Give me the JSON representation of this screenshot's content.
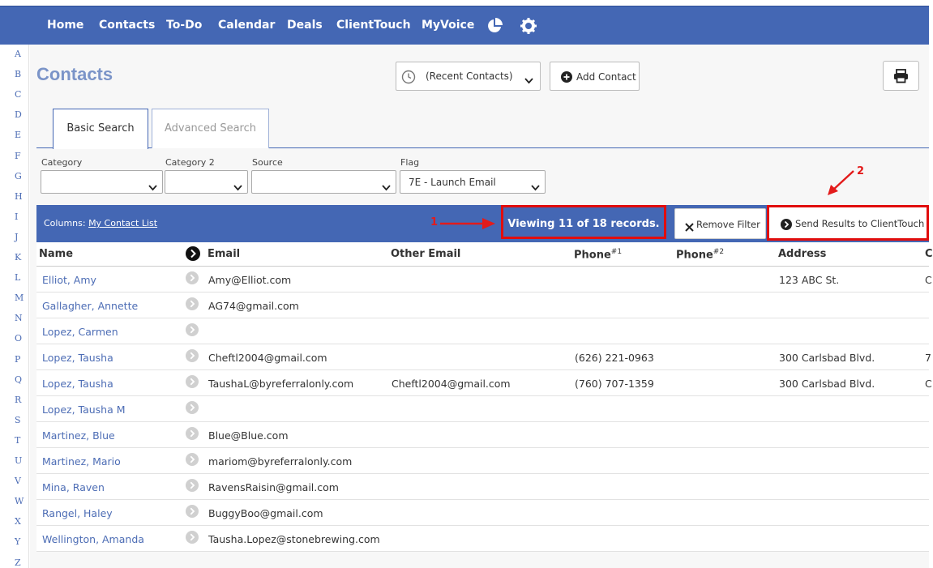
{
  "nav": {
    "items": [
      "Home",
      "Contacts",
      "To-Do",
      "Calendar",
      "Deals",
      "ClientTouch",
      "MyVoice"
    ],
    "icons": [
      "pie-chart-icon",
      "gear-icon"
    ]
  },
  "alphabet": [
    "A",
    "B",
    "C",
    "D",
    "E",
    "F",
    "G",
    "H",
    "I",
    "J",
    "K",
    "L",
    "M",
    "N",
    "O",
    "P",
    "Q",
    "R",
    "S",
    "T",
    "U",
    "V",
    "W",
    "X",
    "Y",
    "Z"
  ],
  "page": {
    "title": "Contacts",
    "recent_select": "(Recent Contacts)",
    "add_contact": "Add Contact"
  },
  "tabs": {
    "basic": "Basic Search",
    "advanced": "Advanced Search"
  },
  "filters": {
    "category": {
      "label": "Category",
      "value": ""
    },
    "category2": {
      "label": "Category 2",
      "value": ""
    },
    "source": {
      "label": "Source",
      "value": ""
    },
    "flag": {
      "label": "Flag",
      "value": "7E - Launch Email"
    }
  },
  "annotations": {
    "one": "1",
    "two": "2"
  },
  "results": {
    "columns_label": "Columns:",
    "columns_link": "My Contact List",
    "viewing": "Viewing 11 of 18 records.",
    "remove_filter": "Remove Filter",
    "send": "Send Results to ClientTouch"
  },
  "table": {
    "headers": {
      "name": "Name",
      "email": "Email",
      "other_email": "Other Email",
      "phone1": "Phone",
      "phone1_sup": "#1",
      "phone2": "Phone",
      "phone2_sup": "#2",
      "address": "Address",
      "cut": "C"
    },
    "rows": [
      {
        "name": "Elliot, Amy",
        "email": "Amy@Elliot.com",
        "other": "",
        "phone1": "",
        "address": "123 ABC St.",
        "cut": "C"
      },
      {
        "name": "Gallagher, Annette",
        "email": "AG74@gmail.com",
        "other": "",
        "phone1": "",
        "address": "",
        "cut": ""
      },
      {
        "name": "Lopez, Carmen",
        "email": "",
        "other": "",
        "phone1": "",
        "address": "",
        "cut": ""
      },
      {
        "name": "Lopez, Tausha",
        "email": "Cheftl2004@gmail.com",
        "other": "",
        "phone1": "(626) 221-0963",
        "address": "300 Carlsbad Blvd.",
        "cut": "7"
      },
      {
        "name": "Lopez, Tausha",
        "email": "TaushaL@byreferralonly.com",
        "other": "Cheftl2004@gmail.com",
        "phone1": "(760) 707-1359",
        "address": "300 Carlsbad Blvd.",
        "cut": "C"
      },
      {
        "name": "Lopez, Tausha M",
        "email": "",
        "other": "",
        "phone1": "",
        "address": "",
        "cut": ""
      },
      {
        "name": "Martinez, Blue",
        "email": "Blue@Blue.com",
        "other": "",
        "phone1": "",
        "address": "",
        "cut": ""
      },
      {
        "name": "Martinez, Mario",
        "email": "mariom@byreferralonly.com",
        "other": "",
        "phone1": "",
        "address": "",
        "cut": ""
      },
      {
        "name": "Mina, Raven",
        "email": "RavensRaisin@gmail.com",
        "other": "",
        "phone1": "",
        "address": "",
        "cut": ""
      },
      {
        "name": "Rangel, Haley",
        "email": "BuggyBoo@gmail.com",
        "other": "",
        "phone1": "",
        "address": "",
        "cut": ""
      },
      {
        "name": "Wellington, Amanda",
        "email": "Tausha.Lopez@stonebrewing.com",
        "other": "",
        "phone1": "",
        "address": "",
        "cut": ""
      }
    ]
  },
  "colors": {
    "nav": "#4467b4",
    "accent": "#4d6db5",
    "highlight": "#e10d0d"
  }
}
